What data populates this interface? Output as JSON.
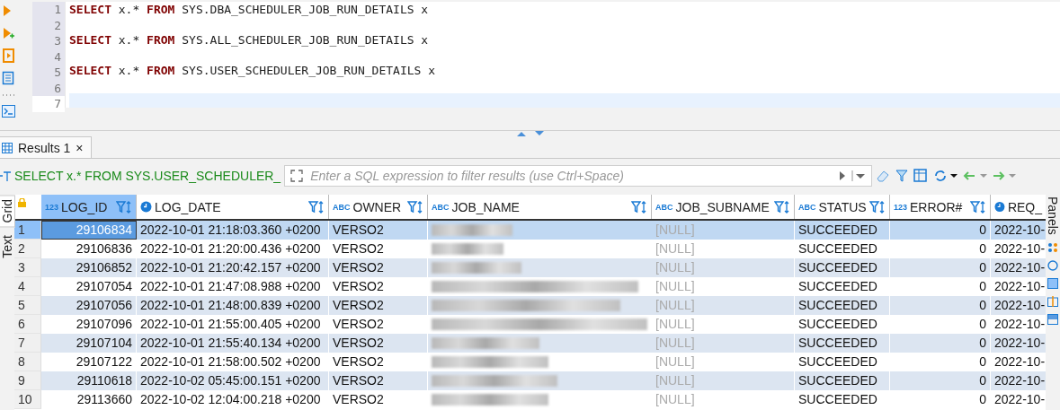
{
  "editor": {
    "lines": [
      {
        "number": "1",
        "current": false,
        "tokens": [
          {
            "kind": "keyword",
            "text": "SELECT"
          },
          {
            "kind": "plain",
            "text": " x.* "
          },
          {
            "kind": "keyword",
            "text": "FROM"
          },
          {
            "kind": "plain",
            "text": " SYS.DBA_SCHEDULER_JOB_RUN_DETAILS x"
          }
        ]
      },
      {
        "number": "2",
        "current": false
      },
      {
        "number": "3",
        "current": false,
        "tokens": [
          {
            "kind": "keyword",
            "text": "SELECT"
          },
          {
            "kind": "plain",
            "text": " x.* "
          },
          {
            "kind": "keyword",
            "text": "FROM"
          },
          {
            "kind": "plain",
            "text": " SYS.ALL_SCHEDULER_JOB_RUN_DETAILS x"
          }
        ]
      },
      {
        "number": "4",
        "current": false
      },
      {
        "number": "5",
        "current": false,
        "tokens": [
          {
            "kind": "keyword",
            "text": "SELECT"
          },
          {
            "kind": "plain",
            "text": " x.* "
          },
          {
            "kind": "keyword",
            "text": "FROM"
          },
          {
            "kind": "plain",
            "text": " SYS.USER_SCHEDULER_JOB_RUN_DETAILS x"
          }
        ]
      },
      {
        "number": "6",
        "current": false
      },
      {
        "number": "7",
        "current": true
      }
    ]
  },
  "results_tab": {
    "label": "Results 1",
    "close": "×",
    "selected": true
  },
  "filter_bar": {
    "query": "SELECT x.* FROM SYS.USER_SCHEDULER_",
    "placeholder": "Enter a SQL expression to filter results (use Ctrl+Space)"
  },
  "view_tabs": [
    {
      "label": "Grid",
      "selected": true
    },
    {
      "label": "Text",
      "selected": false
    }
  ],
  "side_panel": {
    "label": "Panels"
  },
  "table": {
    "columns": [
      {
        "name": "LOG_ID",
        "kind": "number",
        "badge": "123",
        "selected": true
      },
      {
        "name": "LOG_DATE",
        "kind": "date",
        "selected": false
      },
      {
        "name": "OWNER",
        "kind": "text",
        "badge": "ABC",
        "selected": false
      },
      {
        "name": "JOB_NAME",
        "kind": "text",
        "badge": "ABC",
        "selected": false
      },
      {
        "name": "JOB_SUBNAME",
        "kind": "text",
        "badge": "ABC",
        "selected": false
      },
      {
        "name": "STATUS",
        "kind": "text",
        "badge": "ABC",
        "selected": false
      },
      {
        "name": "ERROR#",
        "kind": "number",
        "badge": "123",
        "selected": false
      },
      {
        "name": "REQ_",
        "kind": "date",
        "selected": false
      }
    ],
    "rows": [
      {
        "row_number": "1",
        "selected": true,
        "log_id": "29106834",
        "log_date": "2022-10-01 21:18:03.360 +0200",
        "owner": "VERSO2",
        "job_subname": "[NULL]",
        "status": "SUCCEEDED",
        "error": "0",
        "req": "2022-10-"
      },
      {
        "row_number": "2",
        "selected": false,
        "log_id": "29106836",
        "log_date": "2022-10-01 21:20:00.436 +0200",
        "owner": "VERSO2",
        "job_subname": "[NULL]",
        "status": "SUCCEEDED",
        "error": "0",
        "req": "2022-10-"
      },
      {
        "row_number": "3",
        "selected": false,
        "log_id": "29106852",
        "log_date": "2022-10-01 21:20:42.157 +0200",
        "owner": "VERSO2",
        "job_subname": "[NULL]",
        "status": "SUCCEEDED",
        "error": "0",
        "req": "2022-10-"
      },
      {
        "row_number": "4",
        "selected": false,
        "log_id": "29107054",
        "log_date": "2022-10-01 21:47:08.988 +0200",
        "owner": "VERSO2",
        "job_subname": "[NULL]",
        "status": "SUCCEEDED",
        "error": "0",
        "req": "2022-10-"
      },
      {
        "row_number": "5",
        "selected": false,
        "log_id": "29107056",
        "log_date": "2022-10-01 21:48:00.839 +0200",
        "owner": "VERSO2",
        "job_subname": "[NULL]",
        "status": "SUCCEEDED",
        "error": "0",
        "req": "2022-10-"
      },
      {
        "row_number": "6",
        "selected": false,
        "log_id": "29107096",
        "log_date": "2022-10-01 21:55:00.405 +0200",
        "owner": "VERSO2",
        "job_subname": "[NULL]",
        "status": "SUCCEEDED",
        "error": "0",
        "req": "2022-10-"
      },
      {
        "row_number": "7",
        "selected": false,
        "log_id": "29107104",
        "log_date": "2022-10-01 21:55:40.134 +0200",
        "owner": "VERSO2",
        "job_subname": "[NULL]",
        "status": "SUCCEEDED",
        "error": "0",
        "req": "2022-10-"
      },
      {
        "row_number": "8",
        "selected": false,
        "log_id": "29107122",
        "log_date": "2022-10-01 21:58:00.502 +0200",
        "owner": "VERSO2",
        "job_subname": "[NULL]",
        "status": "SUCCEEDED",
        "error": "0",
        "req": "2022-10-"
      },
      {
        "row_number": "9",
        "selected": false,
        "log_id": "29110618",
        "log_date": "2022-10-02 05:45:00.151 +0200",
        "owner": "VERSO2",
        "job_subname": "[NULL]",
        "status": "SUCCEEDED",
        "error": "0",
        "req": "2022-10-"
      },
      {
        "row_number": "10",
        "selected": false,
        "log_id": "29113660",
        "log_date": "2022-10-02 12:04:00.218 +0200",
        "owner": "VERSO2",
        "job_subname": "[NULL]",
        "status": "SUCCEEDED",
        "error": "0",
        "req": "2022-10-"
      }
    ]
  }
}
